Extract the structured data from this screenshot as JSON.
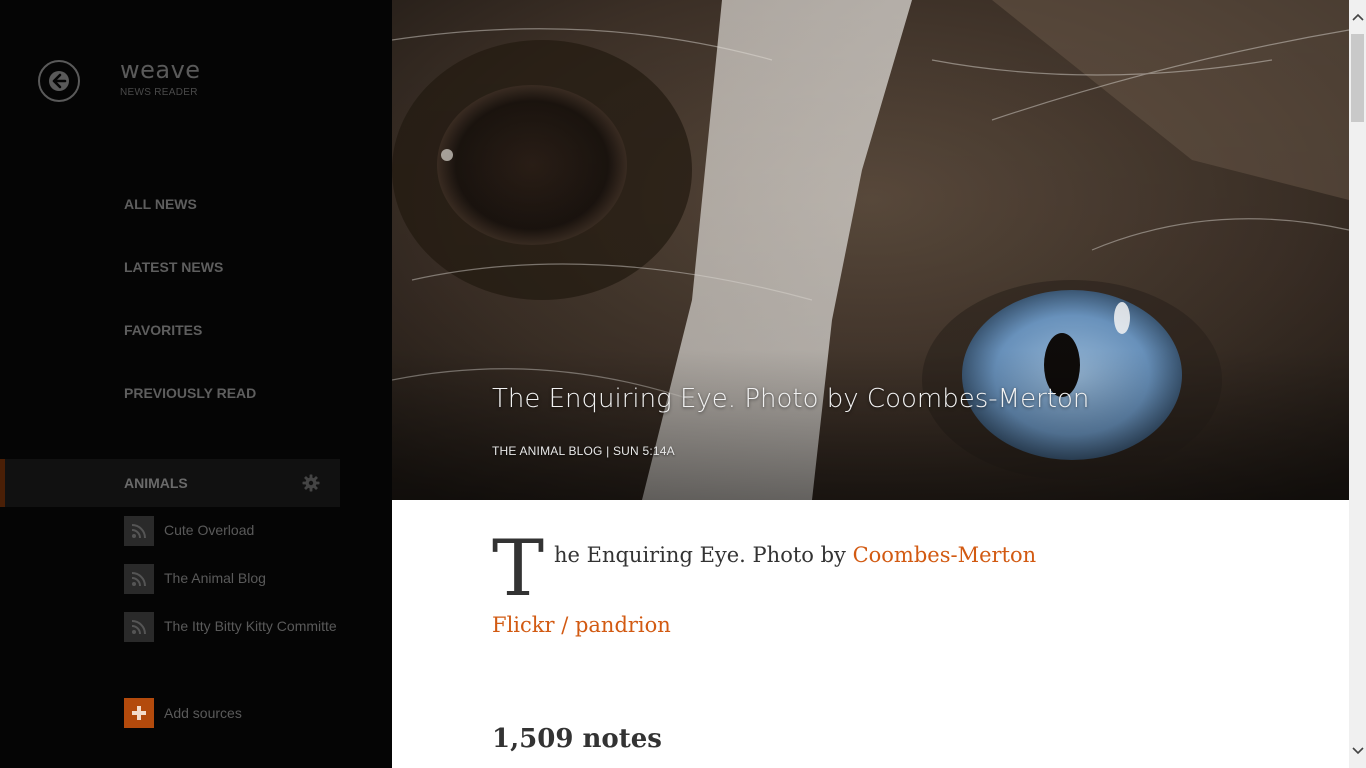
{
  "app": {
    "title": "weave",
    "subtitle": "NEWS READER"
  },
  "nav": {
    "items": [
      {
        "label": "ALL NEWS"
      },
      {
        "label": "LATEST NEWS"
      },
      {
        "label": "FAVORITES"
      },
      {
        "label": "PREVIOUSLY READ"
      }
    ]
  },
  "category": {
    "label": "ANIMALS",
    "settings_icon": "gear-icon",
    "sources": [
      {
        "label": "Cute Overload",
        "icon": "rss-icon"
      },
      {
        "label": "The Animal Blog",
        "icon": "rss-icon"
      },
      {
        "label": "The Itty Bitty Kitty Committee",
        "icon": "rss-icon"
      }
    ]
  },
  "add_sources": {
    "label": "Add sources",
    "icon": "plus-icon"
  },
  "article": {
    "hero_title": "The Enquiring Eye. Photo by Coombes-Merton",
    "hero_meta": "THE ANIMAL BLOG | SUN 5:14A",
    "dropcap": "T",
    "first_line_text": "he Enquiring Eye. Photo by ",
    "photographer_link": "Coombes-Merton",
    "flickr_link": "Flickr / pandrion",
    "notes": "1,509 notes"
  },
  "colors": {
    "accent": "#d25a12",
    "sidebar_bg": "#050505",
    "article_bg": "#ffffff"
  }
}
